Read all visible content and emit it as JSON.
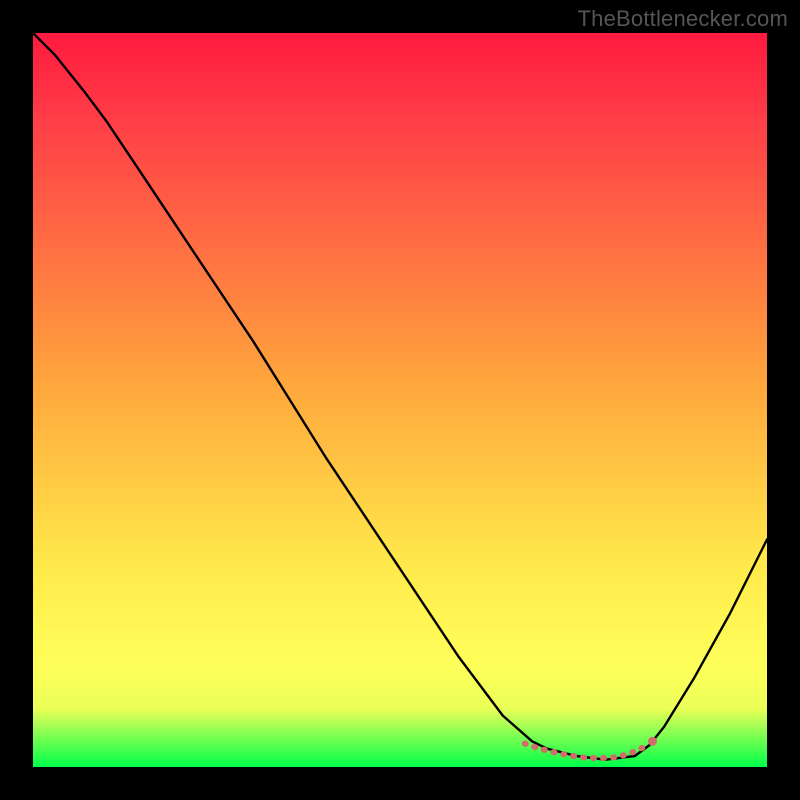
{
  "watermark": "TheBottlenecker.com",
  "chart_data": {
    "type": "line",
    "title": "",
    "xlabel": "",
    "ylabel": "",
    "xlim": [
      0,
      100
    ],
    "ylim": [
      0,
      100
    ],
    "background": {
      "type": "vertical_gradient",
      "stops": [
        {
          "pos": 0.0,
          "color": "#ff1a3f"
        },
        {
          "pos": 0.12,
          "color": "#ff3e47"
        },
        {
          "pos": 0.28,
          "color": "#ff6b43"
        },
        {
          "pos": 0.48,
          "color": "#ffa73d"
        },
        {
          "pos": 0.72,
          "color": "#ffe84a"
        },
        {
          "pos": 0.86,
          "color": "#ffff5a"
        },
        {
          "pos": 0.92,
          "color": "#ecff58"
        },
        {
          "pos": 1.0,
          "color": "#00ff4a"
        }
      ]
    },
    "series": [
      {
        "name": "bottleneck-curve",
        "stroke": "#000000",
        "x": [
          0.0,
          3.0,
          7.0,
          10.0,
          14.0,
          20.0,
          30.0,
          40.0,
          50.0,
          58.0,
          64.0,
          68.0,
          70.0,
          74.0,
          78.0,
          82.0,
          84.0,
          86.0,
          90.0,
          95.0,
          100.0
        ],
        "y": [
          100.0,
          97.0,
          92.0,
          88.0,
          82.0,
          73.0,
          58.0,
          42.0,
          27.0,
          15.0,
          7.0,
          3.5,
          2.5,
          1.5,
          1.0,
          1.5,
          3.0,
          5.5,
          12.0,
          21.0,
          31.0
        ]
      },
      {
        "name": "optimal-band",
        "stroke": "#d46a6a",
        "style": "rough-dotted",
        "x": [
          67.0,
          69.0,
          71.0,
          73.0,
          75.0,
          77.0,
          79.0,
          81.0,
          83.0,
          84.0
        ],
        "y": [
          3.2,
          2.5,
          2.0,
          1.6,
          1.3,
          1.2,
          1.3,
          1.7,
          2.6,
          3.2
        ]
      }
    ],
    "markers": [
      {
        "name": "optimal-end-dot",
        "x": 84.4,
        "y": 3.5,
        "color": "#d46a6a"
      }
    ]
  }
}
